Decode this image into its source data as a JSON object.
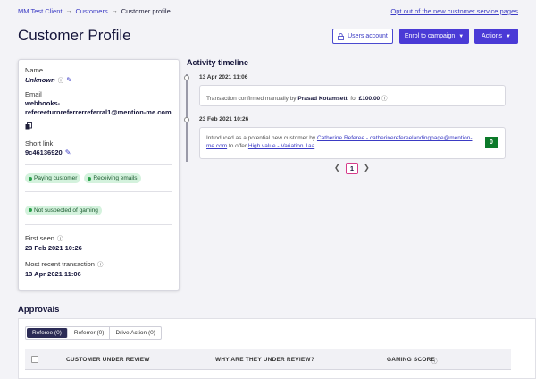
{
  "breadcrumb": {
    "client": "MM Test Client",
    "customers": "Customers",
    "current": "Customer profile",
    "separator": "→"
  },
  "optout_link": "Opt out of the new customer service pages",
  "page_title": "Customer Profile",
  "header_actions": {
    "users_account": "Users account",
    "enrol": "Enrol to campaign",
    "actions": "Actions"
  },
  "profile": {
    "name_label": "Name",
    "name_value": "Unknown",
    "email_label": "Email",
    "email_value_line1": "webhooks-",
    "email_value_line2": "refereeturnreferrerreferral1@mention-me.com",
    "short_link_label": "Short link",
    "short_link_value": "9c46136920",
    "badges": [
      "Paying customer",
      "Receiving emails"
    ],
    "gaming_badge": "Not suspected of gaming",
    "first_seen_label": "First seen",
    "first_seen_value": "23 Feb 2021 10:26",
    "recent_tx_label": "Most recent transaction",
    "recent_tx_value": "13 Apr 2021 11:06"
  },
  "timeline": {
    "title": "Activity timeline",
    "entries": [
      {
        "date": "13 Apr 2021 11:06",
        "text_prefix": "Transaction confirmed manually by",
        "person": "Prasad Kotamsetti",
        "text_mid": "for",
        "amount": "£100.00"
      },
      {
        "date": "23 Feb 2021 10:26",
        "text_prefix": "Introduced as a potential new customer by",
        "referrer_link": "Catherine Referee - catherinerefereelandingpage@mention-me.com",
        "text_mid": "to offer",
        "offer_link": "High value - Variation 1aa",
        "score": "0"
      }
    ],
    "page": "1"
  },
  "approvals": {
    "title": "Approvals",
    "tabs": [
      "Referee (0)",
      "Referrer (0)",
      "Drive Action (0)"
    ],
    "columns": [
      "CUSTOMER UNDER REVIEW",
      "WHY ARE THEY UNDER REVIEW?",
      "GAMING SCORE"
    ]
  },
  "colors": {
    "accent": "#4a3ad6",
    "link": "#3b3bc4",
    "success_badge": "#d4f2dd",
    "score": "#0c7a2a",
    "page_highlight": "#d63a8a"
  }
}
